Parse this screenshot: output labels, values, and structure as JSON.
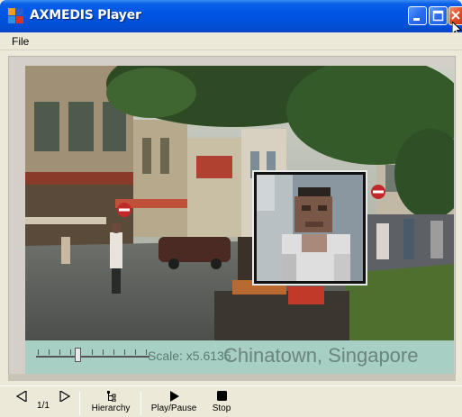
{
  "window": {
    "title": "AXMEDIS Player",
    "accent": "#0054e3"
  },
  "menu": {
    "items": [
      "File"
    ]
  },
  "player": {
    "scale_label": "Scale: x5.6135",
    "location_caption": "Chinatown, Singapore",
    "subbar_color": "#a8cfc4"
  },
  "toolbar": {
    "prev_label": "",
    "next_label": "",
    "page_counter": "1/1",
    "hierarchy_label": "Hierarchy",
    "play_pause_label": "Play/Pause",
    "stop_label": "Stop"
  },
  "icons": {
    "app": "axmedis-logo-icon",
    "minimize": "minimize-icon",
    "maximize": "maximize-icon",
    "close": "close-icon",
    "prev": "triangle-left-icon",
    "next": "triangle-right-icon",
    "hierarchy": "tree-icon",
    "play": "play-icon",
    "stop": "stop-icon"
  }
}
